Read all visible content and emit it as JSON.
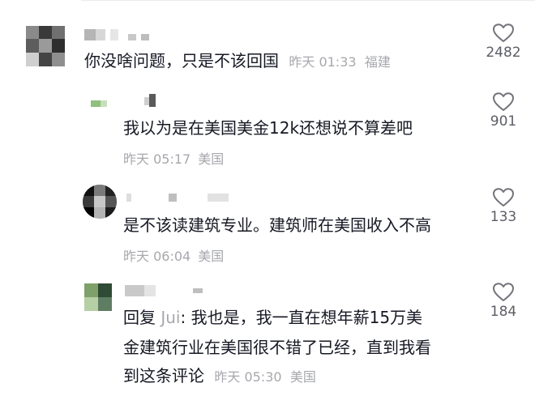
{
  "comments": [
    {
      "text": "你没啥问题，只是不该回国",
      "time": "昨天 01:33",
      "location": "福建",
      "likes": "2482"
    },
    {
      "text": "我以为是在美国美金12k还想说不算差吧",
      "time": "昨天 05:17",
      "location": "美国",
      "likes": "901"
    },
    {
      "text": "是不该读建筑专业。建筑师在美国收入不高",
      "time": "昨天 06:04",
      "location": "美国",
      "likes": "133"
    },
    {
      "reply_prefix": "回复",
      "reply_to": "Jui",
      "reply_colon": ":",
      "text_line1": "我也是，我一直在想年薪15万美",
      "text_line2": "金建筑行业在美国很不错了已经，直到我看",
      "text_line3": "到这条评论",
      "time": "昨天 05:30",
      "location": "美国",
      "likes": "184"
    }
  ],
  "icons": {
    "like": "heart-outline-icon"
  },
  "colors": {
    "text": "#161823",
    "meta": "#a7a8ad",
    "like_count": "#5c5e66"
  }
}
